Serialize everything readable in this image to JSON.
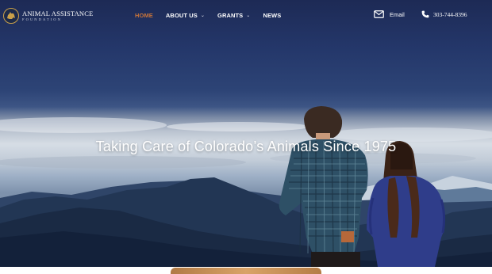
{
  "brand": {
    "name": "ANIMAL ASSISTANCE",
    "subtitle": "FOUNDATION",
    "logo_icon": "dog-silhouette-icon"
  },
  "nav": {
    "items": [
      {
        "label": "HOME",
        "active": true,
        "has_dropdown": false
      },
      {
        "label": "ABOUT US",
        "active": false,
        "has_dropdown": true
      },
      {
        "label": "GRANTS",
        "active": false,
        "has_dropdown": true
      },
      {
        "label": "NEWS",
        "active": false,
        "has_dropdown": false
      }
    ],
    "dropdown_icon": "chevron-down-icon"
  },
  "contact": {
    "email_label": "Email",
    "email_icon": "envelope-icon",
    "phone_label": "303-744-8396",
    "phone_icon": "phone-icon"
  },
  "hero": {
    "title": "Taking Care of Colorado’s Animals Since 1975"
  },
  "colors": {
    "active_nav": "#c8743a",
    "sky_top": "#1d2a55",
    "text": "#ffffff"
  }
}
